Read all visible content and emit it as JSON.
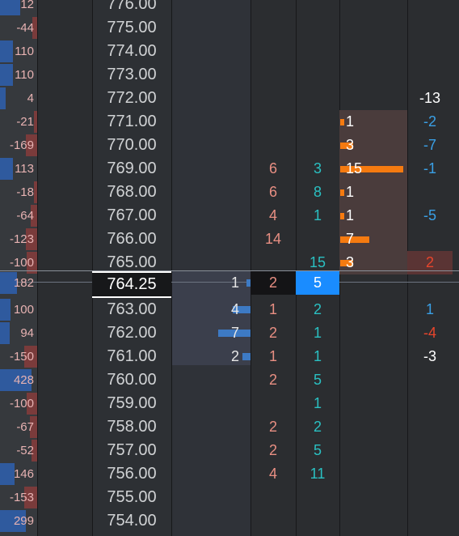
{
  "colors": {
    "ask_bar": "#7a3b3b",
    "bid_bar": "#2f5a9e",
    "accent": "#1a8cff",
    "vol_bar": "#f57a10",
    "buy_text": "#2ac0c2",
    "sell_text": "#e98f83"
  },
  "current_price": "764.25",
  "rows": [
    {
      "delta": "12",
      "price": "776.00",
      "dsign": "pos"
    },
    {
      "delta": "-44",
      "price": "775.00",
      "dsign": "neg"
    },
    {
      "delta": "110",
      "price": "774.00",
      "dsign": "pos"
    },
    {
      "delta": "110",
      "price": "773.00",
      "dsign": "pos"
    },
    {
      "delta": "4",
      "price": "772.00",
      "dsign": "pos",
      "last": "-13",
      "lastc": "#ffffff"
    },
    {
      "delta": "-21",
      "price": "771.00",
      "dsign": "neg",
      "vol": "1",
      "volw": 5,
      "last": "-2",
      "lastc": "#3aa0e6"
    },
    {
      "delta": "-169",
      "price": "770.00",
      "dsign": "neg",
      "vol": "3",
      "volw": 16,
      "last": "-7",
      "lastc": "#3aa0e6"
    },
    {
      "delta": "113",
      "price": "769.00",
      "dsign": "pos",
      "sell": "6",
      "buy": "3",
      "vol": "15",
      "volw": 78,
      "last": "-1",
      "lastc": "#3aa0e6"
    },
    {
      "delta": "-18",
      "price": "768.00",
      "dsign": "neg",
      "sell": "6",
      "buy": "8",
      "vol": "1",
      "volw": 5
    },
    {
      "delta": "-64",
      "price": "767.00",
      "dsign": "neg",
      "sell": "4",
      "buy": "1",
      "vol": "1",
      "volw": 5,
      "last": "-5",
      "lastc": "#3aa0e6"
    },
    {
      "delta": "-123",
      "price": "766.00",
      "dsign": "neg",
      "sell": "14",
      "vol": "7",
      "volw": 36
    },
    {
      "delta": "-100",
      "price": "765.00",
      "dsign": "neg",
      "buy": "15",
      "vol": "3",
      "volw": 16,
      "last": "2",
      "lastc": "#e8452c"
    },
    {
      "delta": "182",
      "price": "764.25",
      "dsign": "pos",
      "bid": "1",
      "bidw": 5,
      "sell": "2",
      "buy": "5",
      "current": true
    },
    {
      "delta": "100",
      "price": "763.00",
      "dsign": "pos",
      "bid": "4",
      "bidw": 22,
      "sell": "1",
      "buy": "2",
      "last": "1",
      "lastc": "#3aa0e6"
    },
    {
      "delta": "94",
      "price": "762.00",
      "dsign": "pos",
      "bid": "7",
      "bidw": 40,
      "sell": "2",
      "buy": "1",
      "last": "-4",
      "lastc": "#e8452c"
    },
    {
      "delta": "-150",
      "price": "761.00",
      "dsign": "neg",
      "bid": "2",
      "bidw": 10,
      "sell": "1",
      "buy": "1",
      "last": "-3",
      "lastc": "#ffffff"
    },
    {
      "delta": "428",
      "price": "760.00",
      "dsign": "pos",
      "sell": "2",
      "buy": "5"
    },
    {
      "delta": "-100",
      "price": "759.00",
      "dsign": "neg",
      "buy": "1"
    },
    {
      "delta": "-67",
      "price": "758.00",
      "dsign": "neg",
      "sell": "2",
      "buy": "2"
    },
    {
      "delta": "-52",
      "price": "757.00",
      "dsign": "neg",
      "sell": "2",
      "buy": "5"
    },
    {
      "delta": "146",
      "price": "756.00",
      "dsign": "pos",
      "sell": "4",
      "buy": "11"
    },
    {
      "delta": "-153",
      "price": "755.00",
      "dsign": "neg"
    },
    {
      "delta": "299",
      "price": "754.00",
      "dsign": "pos"
    }
  ],
  "delta_fill": [
    0.55,
    0.12,
    0.35,
    0.35,
    0.15,
    0.08,
    0.3,
    0.35,
    0.08,
    0.18,
    0.3,
    0.28,
    0.45,
    0.28,
    0.27,
    0.35,
    0.85,
    0.28,
    0.2,
    0.16,
    0.4,
    0.35,
    0.7
  ]
}
